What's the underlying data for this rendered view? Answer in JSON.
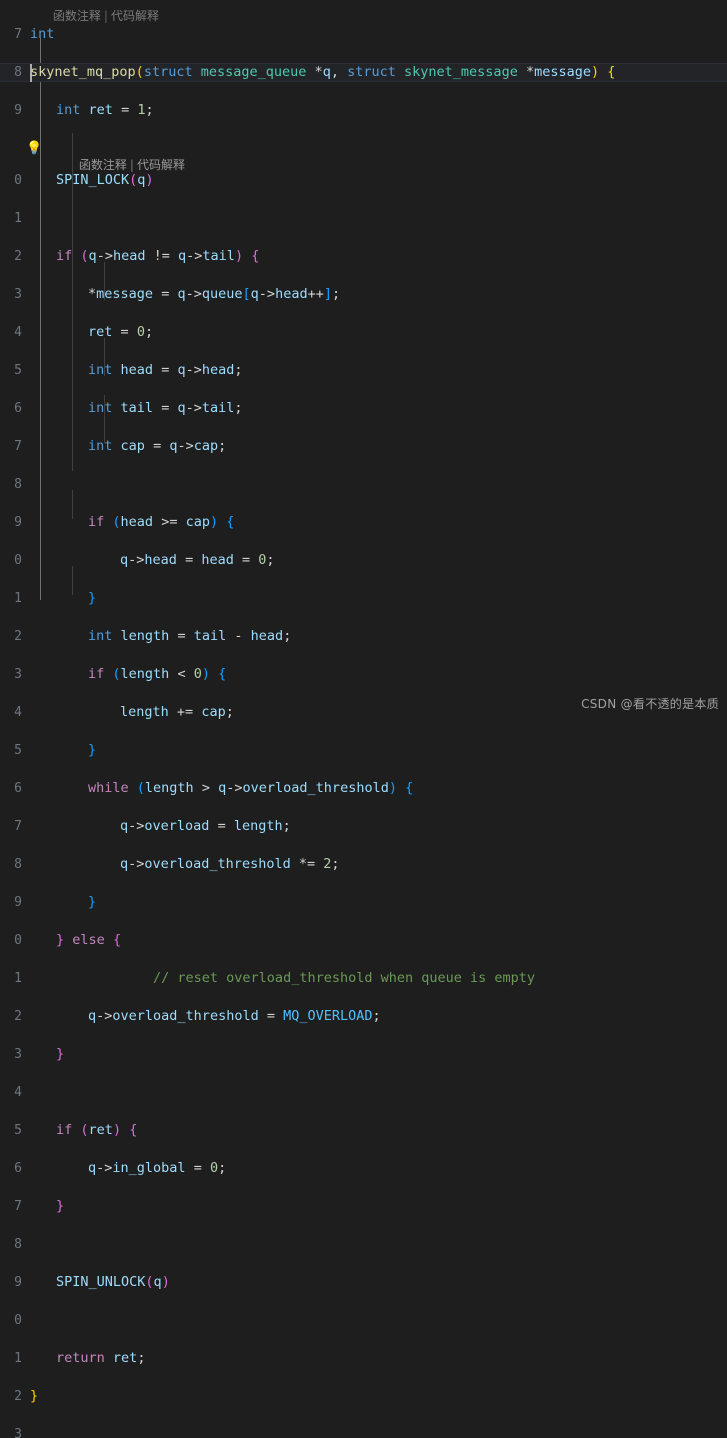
{
  "app": {
    "kind": "code-editor",
    "language": "C",
    "theme": "Dark+ (dark background)",
    "background": "#1e1e1e",
    "current_line_background": "#222428"
  },
  "colors": {
    "keyword": "#569cd6",
    "control": "#c586c0",
    "function": "#dcdcaa",
    "type": "#4ec9b0",
    "variable": "#9cdcfe",
    "number": "#b5cea8",
    "comment": "#6a9955",
    "operator": "#d4d4d4",
    "bracket_level_0": "#ffd700",
    "bracket_level_1": "#da70d6",
    "bracket_level_2": "#179fff",
    "macro": "#4fc1ff",
    "line_number": "#6e7681",
    "codelens": "#999999",
    "lightbulb": "#ffcc00"
  },
  "codelens_top": {
    "visible": true,
    "items": [
      "函数注释",
      "代码解释"
    ],
    "separator": "|"
  },
  "codelens_signature": {
    "visible": true,
    "items": [
      "函数注释",
      "代码解释"
    ],
    "separator": "|"
  },
  "quick_fix": {
    "icon": "lightbulb-icon",
    "glyph": "💡",
    "line": "29"
  },
  "lines": [
    {
      "number": "7",
      "text": "int"
    },
    {
      "number": "8",
      "text": "skynet_mq_pop(struct message_queue *q, struct skynet_message *message) {"
    },
    {
      "number": "9",
      "text": "    int ret = 1;"
    },
    {
      "number": "",
      "text": "函数注释 | 代码解释"
    },
    {
      "number": "0",
      "text": "    SPIN_LOCK(q)"
    },
    {
      "number": "1",
      "text": ""
    },
    {
      "number": "2",
      "text": "    if (q->head != q->tail) {"
    },
    {
      "number": "3",
      "text": "        *message = q->queue[q->head++];"
    },
    {
      "number": "4",
      "text": "        ret = 0;"
    },
    {
      "number": "5",
      "text": "        int head = q->head;"
    },
    {
      "number": "6",
      "text": "        int tail = q->tail;"
    },
    {
      "number": "7",
      "text": "        int cap = q->cap;"
    },
    {
      "number": "8",
      "text": ""
    },
    {
      "number": "9",
      "text": "        if (head >= cap) {"
    },
    {
      "number": "0",
      "text": "            q->head = head = 0;"
    },
    {
      "number": "1",
      "text": "        }"
    },
    {
      "number": "2",
      "text": "        int length = tail - head;"
    },
    {
      "number": "3",
      "text": "        if (length < 0) {"
    },
    {
      "number": "4",
      "text": "            length += cap;"
    },
    {
      "number": "5",
      "text": "        }"
    },
    {
      "number": "6",
      "text": "        while (length > q->overload_threshold) {"
    },
    {
      "number": "7",
      "text": "            q->overload = length;"
    },
    {
      "number": "8",
      "text": "            q->overload_threshold *= 2;"
    },
    {
      "number": "9",
      "text": "        }"
    },
    {
      "number": "0",
      "text": "    } else {"
    },
    {
      "number": "1",
      "text": "        // reset overload_threshold when queue is empty"
    },
    {
      "number": "2",
      "text": "        q->overload_threshold = MQ_OVERLOAD;"
    },
    {
      "number": "3",
      "text": "    }"
    },
    {
      "number": "4",
      "text": ""
    },
    {
      "number": "5",
      "text": "    if (ret) {"
    },
    {
      "number": "6",
      "text": "        q->in_global = 0;"
    },
    {
      "number": "7",
      "text": "    }"
    },
    {
      "number": "8",
      "text": ""
    },
    {
      "number": "9",
      "text": "    SPIN_UNLOCK(q)"
    },
    {
      "number": "0",
      "text": ""
    },
    {
      "number": "1",
      "text": "    return ret;"
    },
    {
      "number": "2",
      "text": "}"
    },
    {
      "number": "3",
      "text": ""
    }
  ],
  "watermark": {
    "text": "CSDN @看不透的是本质"
  }
}
